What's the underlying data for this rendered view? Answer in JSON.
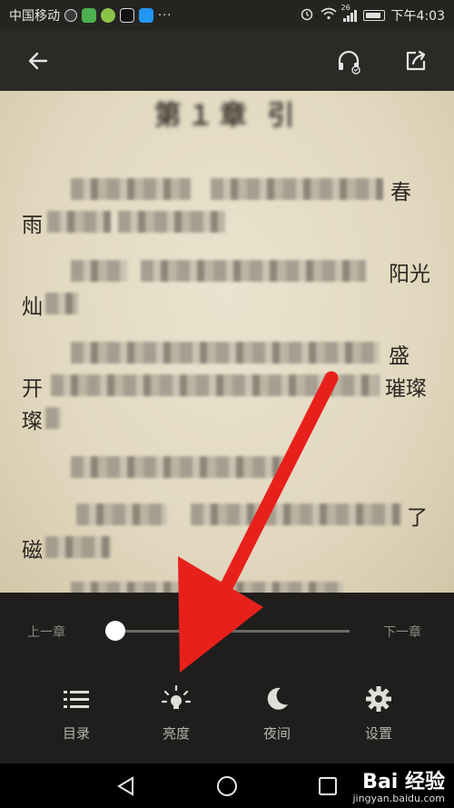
{
  "status_bar": {
    "carrier": "中国移动",
    "network": "26",
    "time": "下午4:03",
    "dots": "···"
  },
  "top_bar": {
    "back_icon": "arrow-left-icon",
    "listen_icon": "headphones-icon",
    "share_icon": "share-icon"
  },
  "reader": {
    "chapter_title": "第１章 引",
    "visible_chars": [
      "春",
      "雨",
      "阳光",
      "灿",
      "盛",
      "开",
      "璀璨",
      "璨",
      "了",
      "磁"
    ]
  },
  "panel": {
    "prev_chapter": "上一章",
    "next_chapter": "下一章",
    "progress_fraction": 0.0,
    "tools": [
      {
        "label": "目录",
        "icon": "list-icon"
      },
      {
        "label": "亮度",
        "icon": "brightness-icon"
      },
      {
        "label": "夜间",
        "icon": "moon-icon"
      },
      {
        "label": "设置",
        "icon": "gear-icon"
      }
    ]
  },
  "watermark": {
    "logo": "Bai 经验",
    "url": "jingyan.baidu.com"
  },
  "colors": {
    "page_bg": "#e6dcc6",
    "panel_bg": "#22201e",
    "arrow": "#e8201c"
  }
}
